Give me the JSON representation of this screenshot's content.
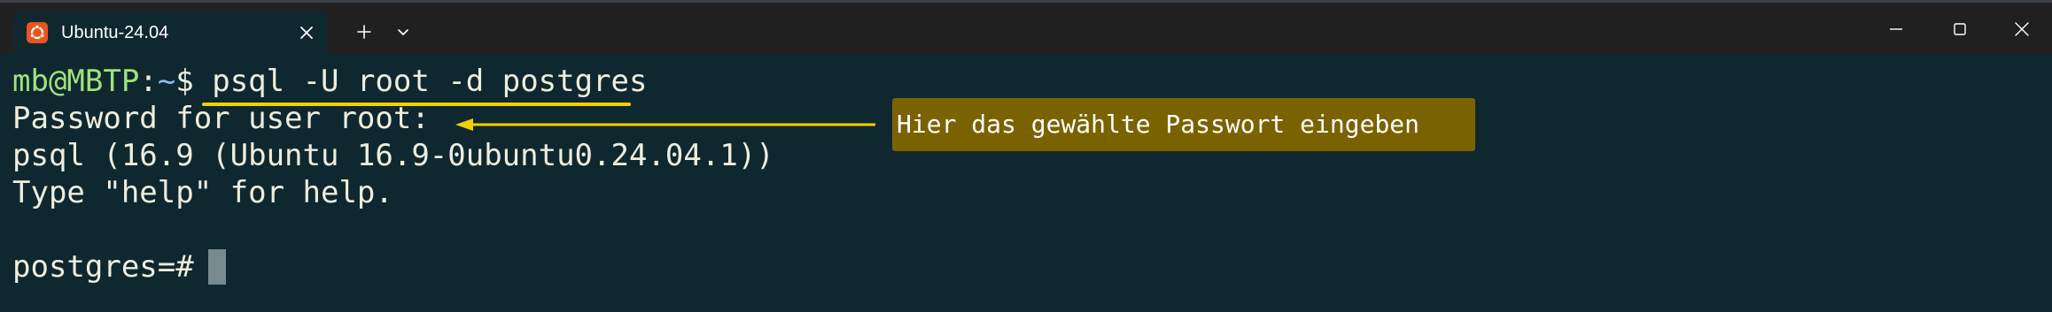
{
  "window": {
    "tab_title": "Ubuntu-24.04",
    "tab_icon": "ubuntu-icon",
    "close_tab_icon": "close-icon",
    "new_tab_icon": "plus-icon",
    "dropdown_icon": "chevron-down-icon",
    "minimize_icon": "minimize-icon",
    "maximize_icon": "maximize-icon",
    "close_window_icon": "close-icon"
  },
  "terminal": {
    "line1": {
      "user_host": "mb@MBTP",
      "sep": ":",
      "path": "~",
      "prompt": "$ ",
      "command": "psql -U root -d postgres"
    },
    "line2": "Password for user root:",
    "line3": "psql (16.9 (Ubuntu 16.9-0ubuntu0.24.04.1))",
    "line4": "Type \"help\" for help.",
    "line6": "postgres=# "
  },
  "annotation": {
    "callout_text": "Hier das gewählte Passwort eingeben",
    "highlight_color": "#f5d000",
    "callout_bg": "#7b6200"
  },
  "colors": {
    "terminal_bg": "#0f2830",
    "titlebar_bg": "#202020",
    "ubuntu_orange": "#e95420"
  }
}
